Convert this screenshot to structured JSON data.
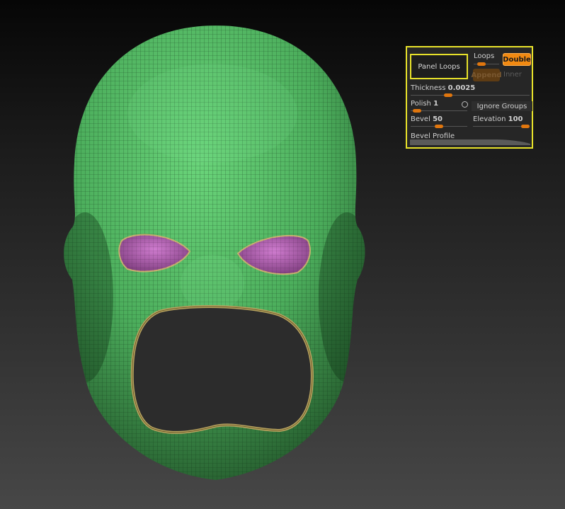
{
  "panel": {
    "title_button": "Panel Loops",
    "loops": {
      "label": "Loops",
      "value_fraction": 0.2
    },
    "double_button": "Double",
    "append_button": "Append",
    "inner_button": "Inner",
    "thickness": {
      "label": "Thickness",
      "value": "0.0025",
      "value_fraction": 0.3
    },
    "polish": {
      "label": "Polish",
      "value": "1",
      "value_fraction": 0.05
    },
    "ignore_groups_button": "Ignore Groups",
    "bevel": {
      "label": "Bevel",
      "value": "50",
      "value_fraction": 0.5
    },
    "elevation": {
      "label": "Elevation",
      "value": "100",
      "value_fraction": 1.0
    },
    "bevel_profile_label": "Bevel Profile"
  },
  "colors": {
    "mesh_green": "#5ac26a",
    "eye_magenta": "#b060b0",
    "panel_border": "#e8e22a",
    "accent_orange": "#f28a12"
  }
}
